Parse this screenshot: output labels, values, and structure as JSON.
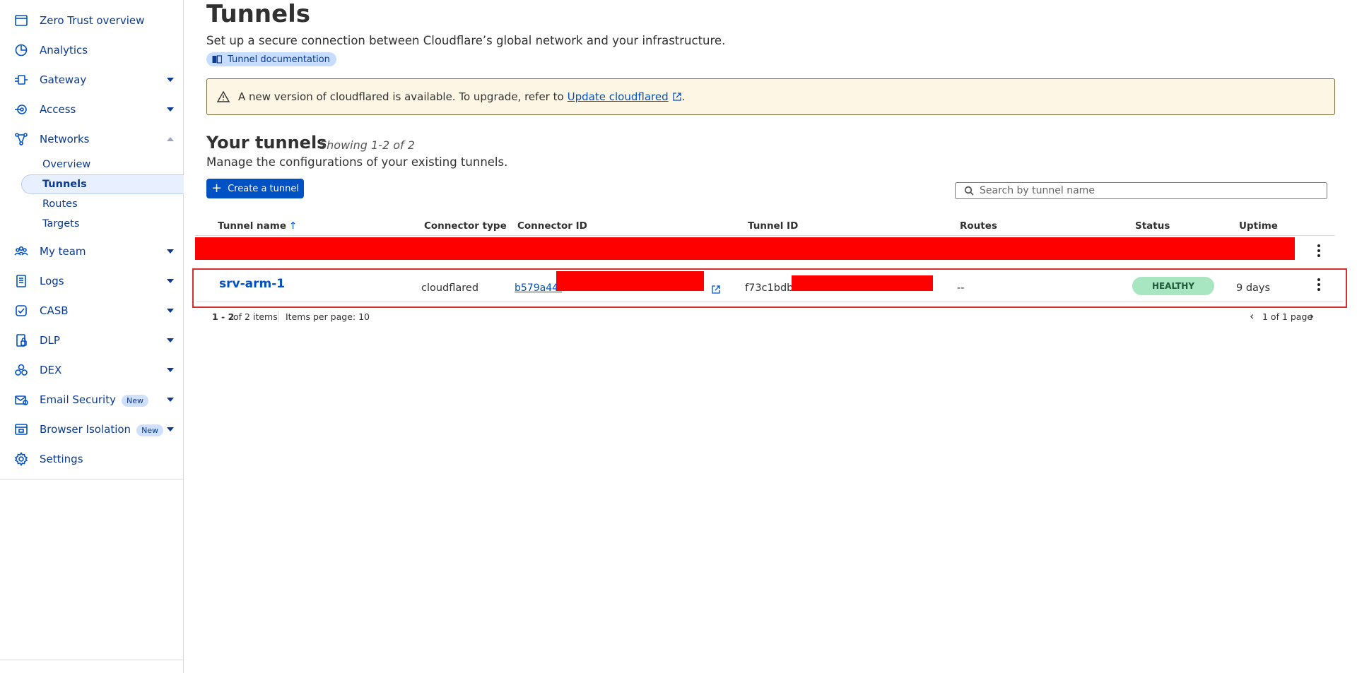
{
  "sidebar": {
    "items": [
      {
        "label": "Zero Trust overview",
        "icon": "browser-window-icon"
      },
      {
        "label": "Analytics",
        "icon": "pie-chart-icon"
      },
      {
        "label": "Gateway",
        "icon": "gateway-icon"
      },
      {
        "label": "Access",
        "icon": "access-icon"
      },
      {
        "label": "Networks",
        "icon": "network-icon"
      },
      {
        "label": "My team",
        "icon": "team-icon"
      },
      {
        "label": "Logs",
        "icon": "logs-icon"
      },
      {
        "label": "CASB",
        "icon": "casb-icon"
      },
      {
        "label": "DLP",
        "icon": "dlp-icon"
      },
      {
        "label": "DEX",
        "icon": "dex-icon"
      },
      {
        "label": "Email Security",
        "icon": "email-security-icon",
        "badge": "New"
      },
      {
        "label": "Browser Isolation",
        "icon": "browser-isolation-icon",
        "badge": "New"
      },
      {
        "label": "Settings",
        "icon": "gear-icon"
      }
    ],
    "networks_sub": [
      "Overview",
      "Tunnels",
      "Routes",
      "Targets"
    ]
  },
  "header": {
    "title": "Tunnels",
    "subtitle": "Set up a secure connection between Cloudflare’s global network and your infrastructure.",
    "doc_link": "Tunnel documentation"
  },
  "banner": {
    "text": "A new version of cloudflared is available. To upgrade, refer to",
    "link": "Update cloudflared",
    "suffix": "."
  },
  "tunnels": {
    "title": "Your tunnels",
    "count": "Showing 1-2 of 2",
    "description": "Manage the configurations of your existing tunnels.",
    "create_label": "Create a tunnel",
    "search_placeholder": "Search by tunnel name",
    "columns": [
      "Tunnel name",
      "Connector type",
      "Connector ID",
      "Tunnel ID",
      "Routes",
      "Status",
      "Uptime"
    ],
    "rows": [
      {
        "name": "srv-arm-1",
        "connector_type": "cloudflared",
        "connector_id": "b579a44f",
        "tunnel_id": "f73c1bdb-",
        "routes": "--",
        "status": "HEALTHY",
        "uptime": "9 days"
      }
    ],
    "pager": {
      "range": "1 - 2",
      "of_items": "of 2 items",
      "per_page": "Items per page: 10",
      "page_info": "1 of 1 page"
    }
  },
  "colors": {
    "accent": "#0051c3",
    "healthy_bg": "#a8e6c1",
    "banner_bg": "#fef6e4",
    "redaction": "#ff0000"
  }
}
